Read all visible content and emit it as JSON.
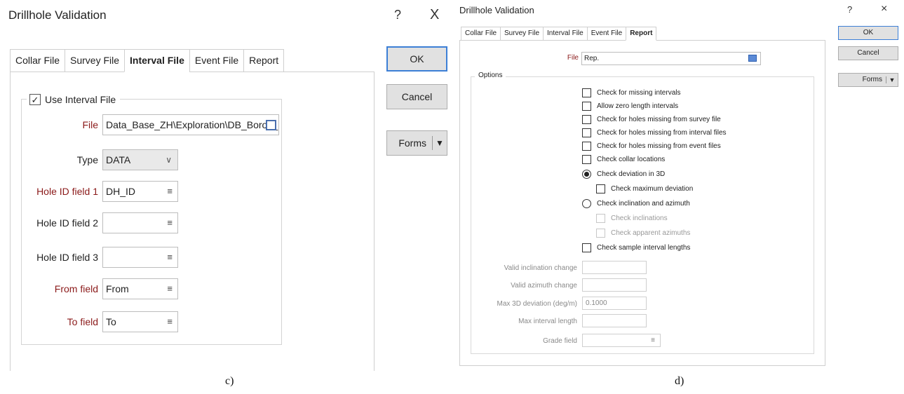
{
  "left_dialog": {
    "title": "Drillhole Validation",
    "help": "?",
    "close": "X",
    "tabs": [
      {
        "label": "Collar File",
        "active": false
      },
      {
        "label": "Survey File",
        "active": false
      },
      {
        "label": "Interval File",
        "active": true
      },
      {
        "label": "Event File",
        "active": false
      },
      {
        "label": "Report",
        "active": false
      }
    ],
    "use_interval_file": {
      "label": "Use Interval File",
      "checked": true,
      "mark": "✓"
    },
    "fields": {
      "file": {
        "label": "File",
        "value": "Data_Base_ZH\\Exploration\\DB_Borov_Doll_"
      },
      "type": {
        "label": "Type",
        "value": "DATA",
        "caret": "∨"
      },
      "hole_id_1": {
        "label": "Hole ID field 1",
        "value": "DH_ID"
      },
      "hole_id_2": {
        "label": "Hole ID field 2",
        "value": ""
      },
      "hole_id_3": {
        "label": "Hole ID field 3",
        "value": ""
      },
      "from": {
        "label": "From field",
        "value": "From"
      },
      "to": {
        "label": "To field",
        "value": "To"
      }
    },
    "menu_glyph": "≡",
    "buttons": {
      "ok": "OK",
      "cancel": "Cancel",
      "forms": "Forms",
      "forms_arrow": "▼"
    },
    "caption": "c)"
  },
  "right_dialog": {
    "title": "Drillhole Validation",
    "help": "?",
    "close": "×",
    "tabs": [
      {
        "label": "Collar File",
        "active": false
      },
      {
        "label": "Survey File",
        "active": false
      },
      {
        "label": "Interval File",
        "active": false
      },
      {
        "label": "Event File",
        "active": false
      },
      {
        "label": "Report",
        "active": true
      }
    ],
    "file": {
      "label": "File",
      "value": "Rep."
    },
    "options_legend": "Options",
    "options": {
      "missing_intervals": {
        "label": "Check for missing intervals",
        "checked": false
      },
      "zero_length": {
        "label": "Allow zero length intervals",
        "checked": false
      },
      "missing_survey": {
        "label": "Check for holes missing from survey file",
        "checked": false
      },
      "missing_interval": {
        "label": "Check for holes missing from interval files",
        "checked": false
      },
      "missing_event": {
        "label": "Check for holes missing from event files",
        "checked": false
      },
      "collar_locations": {
        "label": "Check collar locations",
        "checked": false
      },
      "deviation_3d": {
        "label": "Check deviation in 3D",
        "selected": true
      },
      "max_deviation": {
        "label": "Check maximum deviation",
        "checked": false
      },
      "incl_azimuth": {
        "label": "Check inclination and azimuth",
        "selected": false
      },
      "inclinations": {
        "label": "Check inclinations",
        "checked": false,
        "disabled": true
      },
      "apparent_azimuths": {
        "label": "Check apparent azimuths",
        "checked": false,
        "disabled": true
      },
      "sample_lengths": {
        "label": "Check sample interval lengths",
        "checked": false
      }
    },
    "params": {
      "incl_change": {
        "label": "Valid inclination change",
        "value": ""
      },
      "azimuth_change": {
        "label": "Valid azimuth change",
        "value": ""
      },
      "max_3d": {
        "label": "Max 3D deviation (deg/m)",
        "value": "0.1000"
      },
      "max_interval": {
        "label": "Max interval length",
        "value": ""
      },
      "grade": {
        "label": "Grade field",
        "value": ""
      }
    },
    "menu_glyph": "≡",
    "buttons": {
      "ok": "OK",
      "cancel": "Cancel",
      "forms": "Forms",
      "forms_arrow": "▼"
    },
    "caption": "d)"
  }
}
